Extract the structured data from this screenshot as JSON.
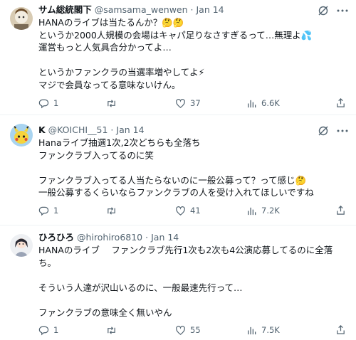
{
  "tweets": [
    {
      "name": "サム総統閣下",
      "handle": "@samsama_wenwen",
      "sep": "·",
      "date": "Jan 14",
      "lines": [
        "HANAのライブは当たるんか？🤔🤔",
        "というか2000人規模の会場はキャパ足りなさすぎるって…無理よ💦",
        "運営もっと人気具合分かってよ…",
        "",
        "というかファンクラの当選率増やしてよ⚡",
        "マジで会員なってる意味ないけん。"
      ],
      "stats": {
        "replies": "1",
        "retweets": "",
        "likes": "37",
        "views": "6.6K"
      }
    },
    {
      "name": "K",
      "handle": "@KOICHI__51",
      "sep": "·",
      "date": "Jan 14",
      "lines": [
        "Hanaライブ抽選1次,2次どちらも全落ち",
        "ファンクラブ入ってるのに笑",
        "",
        "ファンクラブ入ってる人当たらないのに一般公募って？って感じ🤔",
        "一般公募するくらいならファンクラブの人を受け入れてほしいですね"
      ],
      "stats": {
        "replies": "1",
        "retweets": "",
        "likes": "41",
        "views": "7.2K"
      }
    },
    {
      "name": "ひろひろ",
      "handle": "@hirohiro6810",
      "sep": "·",
      "date": "Jan 14",
      "lines": [
        "HANAのライブ　 ファンクラブ先行1次も2次も4公演応募してるのに全落",
        "ち。",
        "",
        "そういう人達が沢山いるのに、一般最速先行って…",
        "",
        "ファンクラブの意味全く無いやん"
      ],
      "stats": {
        "replies": "1",
        "retweets": "",
        "likes": "55",
        "views": "7.5K"
      }
    }
  ],
  "icons": {
    "reply": "reply-icon",
    "retweet": "retweet-icon",
    "like": "heart-icon",
    "views": "views-icon",
    "share": "share-icon",
    "grok": "grok-icon",
    "more": "more-icon"
  },
  "colors": {
    "text": "#0f1419",
    "secondary": "#536471",
    "divider": "#eff3f4"
  }
}
